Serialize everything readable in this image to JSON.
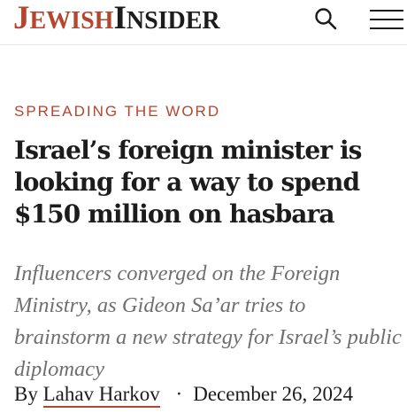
{
  "header": {
    "logo": {
      "part1_initial": "J",
      "part1_rest": "EWISH",
      "part2_initial": "I",
      "part2_rest": "NSIDER"
    },
    "icons": {
      "search": "search-icon",
      "menu": "hamburger-menu-icon"
    }
  },
  "article": {
    "kicker": "SPREADING THE WORD",
    "headline": "Israel’s foreign minister is looking for a way to spend $150 million on hasbara",
    "dek": "Influencers converged on the Foreign Ministry, as Gideon Sa’ar tries to brainstorm a new strategy for Israel’s public diplomacy",
    "byline": {
      "prefix": "By",
      "author": "Lahav Harkov",
      "separator": "·",
      "date": "December 26, 2024"
    }
  },
  "colors": {
    "accent": "#b5452e",
    "text": "#1c1c1c",
    "dek": "#6f6f6f"
  }
}
